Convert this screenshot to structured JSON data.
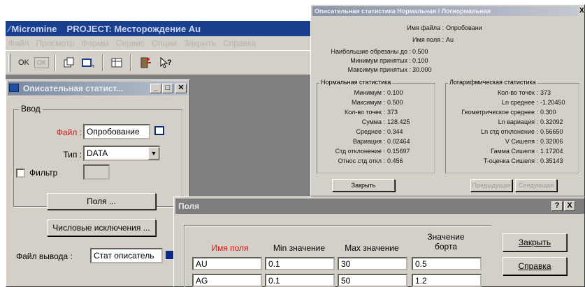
{
  "app": {
    "logo": "⁄⁄⁄",
    "name": "Micromine",
    "project_title": "PROJECT: Месторождение Au",
    "menu": [
      "Файл",
      "Просмотр",
      "Формы",
      "Сервис",
      "Опции",
      "Закрыть",
      "Справка"
    ],
    "toolbar": {
      "ok": "OK",
      "ok_disabled": "OK"
    }
  },
  "descriptive_dialog": {
    "title": "Описательная статист...",
    "group_label": "Ввод",
    "file_label": "Файл :",
    "file_value": "Опробование",
    "type_label": "Тип :",
    "type_value": "DATA",
    "filter_label": "Фильтр",
    "filter_value": "",
    "fields_button": "Поля ...",
    "numeric_exclusions_button": "Числовые исключения ...",
    "output_label": "Файл вывода :",
    "output_value": "Стат описатель"
  },
  "stats_window": {
    "title": "Описательная статистика Нормальная / Логнормальная",
    "close": "X",
    "file_name_label": "Имя файла :",
    "file_name_value": "Опробовани",
    "field_name_label": "Имя поля :",
    "field_name_value": "Au",
    "cut_label": "Наибольшие обрезаны до :",
    "cut_value": "0.500",
    "min_accepted_label": "Минимум принятых :",
    "min_accepted_value": "0.100",
    "max_accepted_label": "Максимум принятых :",
    "max_accepted_value": "30.000",
    "normal_group": "Нормальная статистика",
    "normal": [
      {
        "label": "Минимум :",
        "value": "0.100"
      },
      {
        "label": "Максимум :",
        "value": "0.500"
      },
      {
        "label": "Кол-во точек :",
        "value": "373"
      },
      {
        "label": "Сумма :",
        "value": "128.425"
      },
      {
        "label": "Среднее :",
        "value": "0.344"
      },
      {
        "label": "Вариация :",
        "value": "0.02464"
      },
      {
        "label": "Стд отклонение :",
        "value": "0.15697"
      },
      {
        "label": "Относ стд откл :",
        "value": "0.456"
      }
    ],
    "log_group": "Логарифмическая статистика",
    "log": [
      {
        "label": "Кол-во точек :",
        "value": "373"
      },
      {
        "label": "Ln среднее :",
        "value": "-1.20450"
      },
      {
        "label": "Геометрическое среднее :",
        "value": "0.300"
      },
      {
        "label": "Ln вариация :",
        "value": "0.32092"
      },
      {
        "label": "Ln стд отклонение :",
        "value": "0.56650"
      },
      {
        "label": "V Сишеля :",
        "value": "0.32006"
      },
      {
        "label": "Гамма Сишеля :",
        "value": "1.17204"
      },
      {
        "label": "T-оценка Сишеля :",
        "value": "0.35143"
      }
    ],
    "close_button": "Закрыть",
    "prev_button": "Предыдущая",
    "next_button": "Следующая"
  },
  "fields_dialog": {
    "title": "Поля",
    "help_icon": "?",
    "close_icon": "X",
    "headers": [
      "Имя поля",
      "Min значение",
      "Max значение",
      "Значение\nборта"
    ],
    "rows": [
      [
        "AU",
        "0.1",
        "30",
        "0.5"
      ],
      [
        "AG",
        "0.1",
        "50",
        "1.2"
      ]
    ],
    "close_button": "Закрыть",
    "help_button": "Справка"
  },
  "colors": {
    "title_active": "#1b3f8f",
    "accent_red": "#d11a1a",
    "face": "#d4d0c8"
  }
}
